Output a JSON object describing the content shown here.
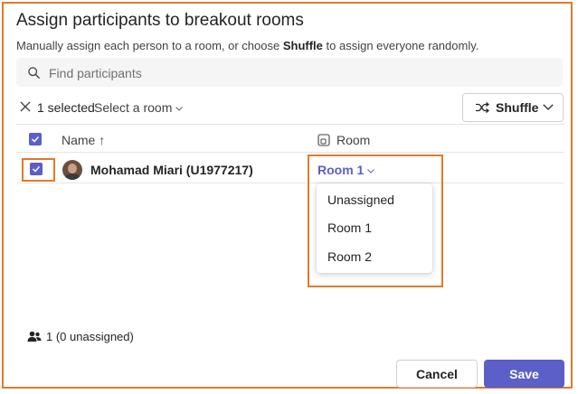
{
  "dialog": {
    "title": "Assign participants to breakout rooms",
    "subtitle_prefix": "Manually assign each person to a room, or choose ",
    "subtitle_bold": "Shuffle",
    "subtitle_suffix": " to assign everyone randomly."
  },
  "search": {
    "placeholder": "Find participants",
    "value": ""
  },
  "toolbar": {
    "selected_text": "1 selected",
    "select_room_label": "Select a room",
    "shuffle_label": "Shuffle"
  },
  "table": {
    "columns": {
      "name": "Name ↑",
      "room": "Room"
    },
    "rows": [
      {
        "name": "Mohamad Miari (U1977217)",
        "room": "Room 1",
        "checked": true
      }
    ]
  },
  "room_dropdown": {
    "options": [
      "Unassigned",
      "Room 1",
      "Room 2"
    ]
  },
  "footer": {
    "count_text": "1 (0 unassigned)",
    "cancel_label": "Cancel",
    "save_label": "Save"
  },
  "colors": {
    "accent": "#5b5fc7",
    "highlight": "#e07b28"
  },
  "icons": {
    "search": "search-icon",
    "clear": "close-icon",
    "shuffle": "shuffle-icon",
    "room": "room-icon",
    "people": "people-icon"
  }
}
